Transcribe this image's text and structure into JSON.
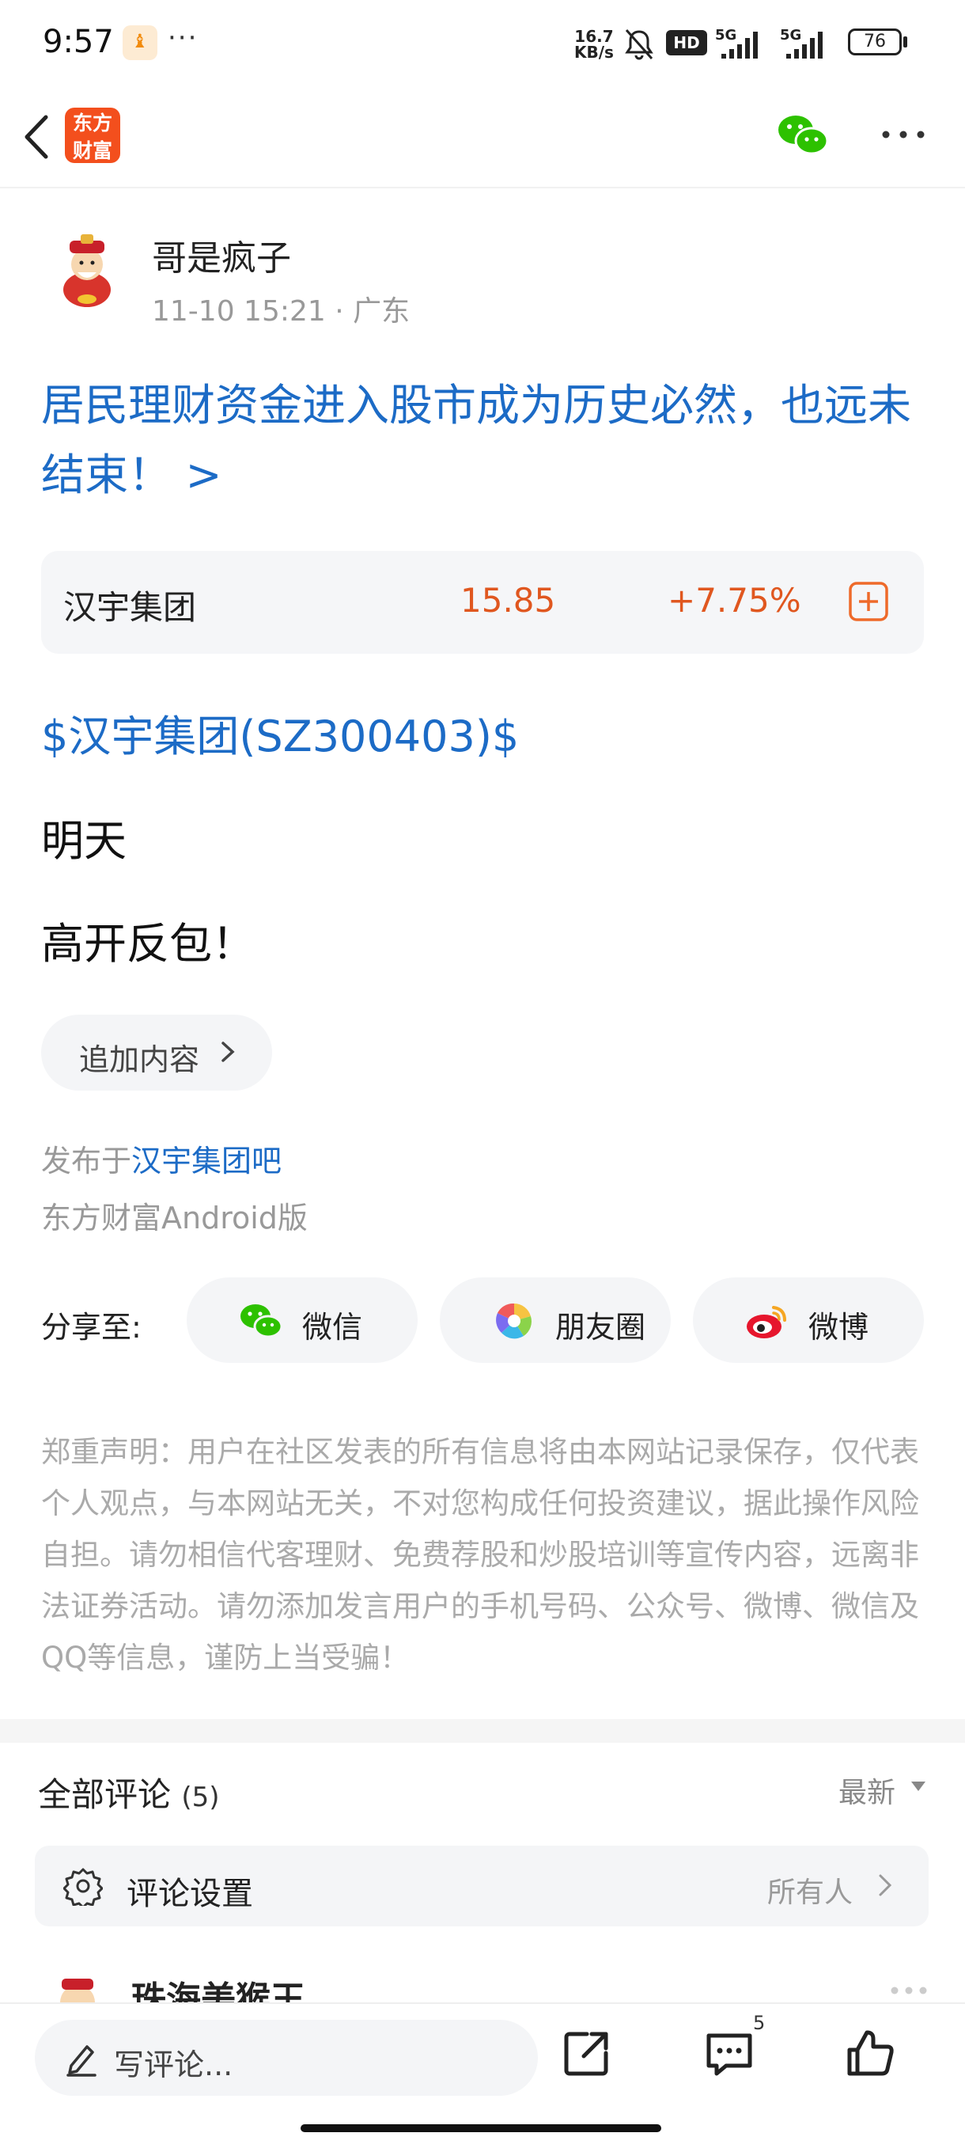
{
  "status_bar": {
    "time": "9:57",
    "app_icon_glyph": "♝",
    "overflow": "···",
    "net_speed_top": "16.7",
    "net_speed_unit": "KB/s",
    "hd_label": "HD",
    "sig1_label": "5G",
    "sig2_label": "5G",
    "battery": "76"
  },
  "header": {
    "logo_line1": "东方",
    "logo_line2": "财富"
  },
  "author": {
    "name": "哥是疯子",
    "time": "11-10 15:21",
    "location": " · 广东"
  },
  "post": {
    "title": "居民理财资金进入股市成为历史必然，也远未结束！ >",
    "stock": {
      "name": "汉宇集团",
      "price": "15.85",
      "change": "+7.75%"
    },
    "cashtag": "$汉宇集团(SZ300403)$",
    "lines": [
      "明天",
      "高开反包！"
    ],
    "append_label": "追加内容",
    "published_prefix": "发布于",
    "published_bar": "汉宇集团吧",
    "client": "东方财富Android版"
  },
  "share": {
    "label": "分享至:",
    "buttons": [
      {
        "label": "微信",
        "icon": "wechat-icon"
      },
      {
        "label": "朋友圈",
        "icon": "moments-icon"
      },
      {
        "label": "微博",
        "icon": "weibo-icon"
      }
    ]
  },
  "disclaimer": "郑重声明：用户在社区发表的所有信息将由本网站记录保存，仅代表个人观点，与本网站无关，不对您构成任何投资建议，据此操作风险自担。请勿相信代客理财、免费荐股和炒股培训等宣传内容，远离非法证券活动。请勿添加发言用户的手机号码、公众号、微博、微信及QQ等信息，谨防上当受骗！",
  "comments": {
    "title": "全部评论",
    "count": "(5)",
    "sort": "最新",
    "settings_label": "评论设置",
    "settings_value": "所有人",
    "first_commenter": "珠海美猴王"
  },
  "bottom_bar": {
    "write_placeholder": "写评论...",
    "comment_badge": "5"
  },
  "colors": {
    "link_blue": "#1c6bc6",
    "up_red": "#e0571f",
    "brand_orange": "#f34f1d"
  }
}
